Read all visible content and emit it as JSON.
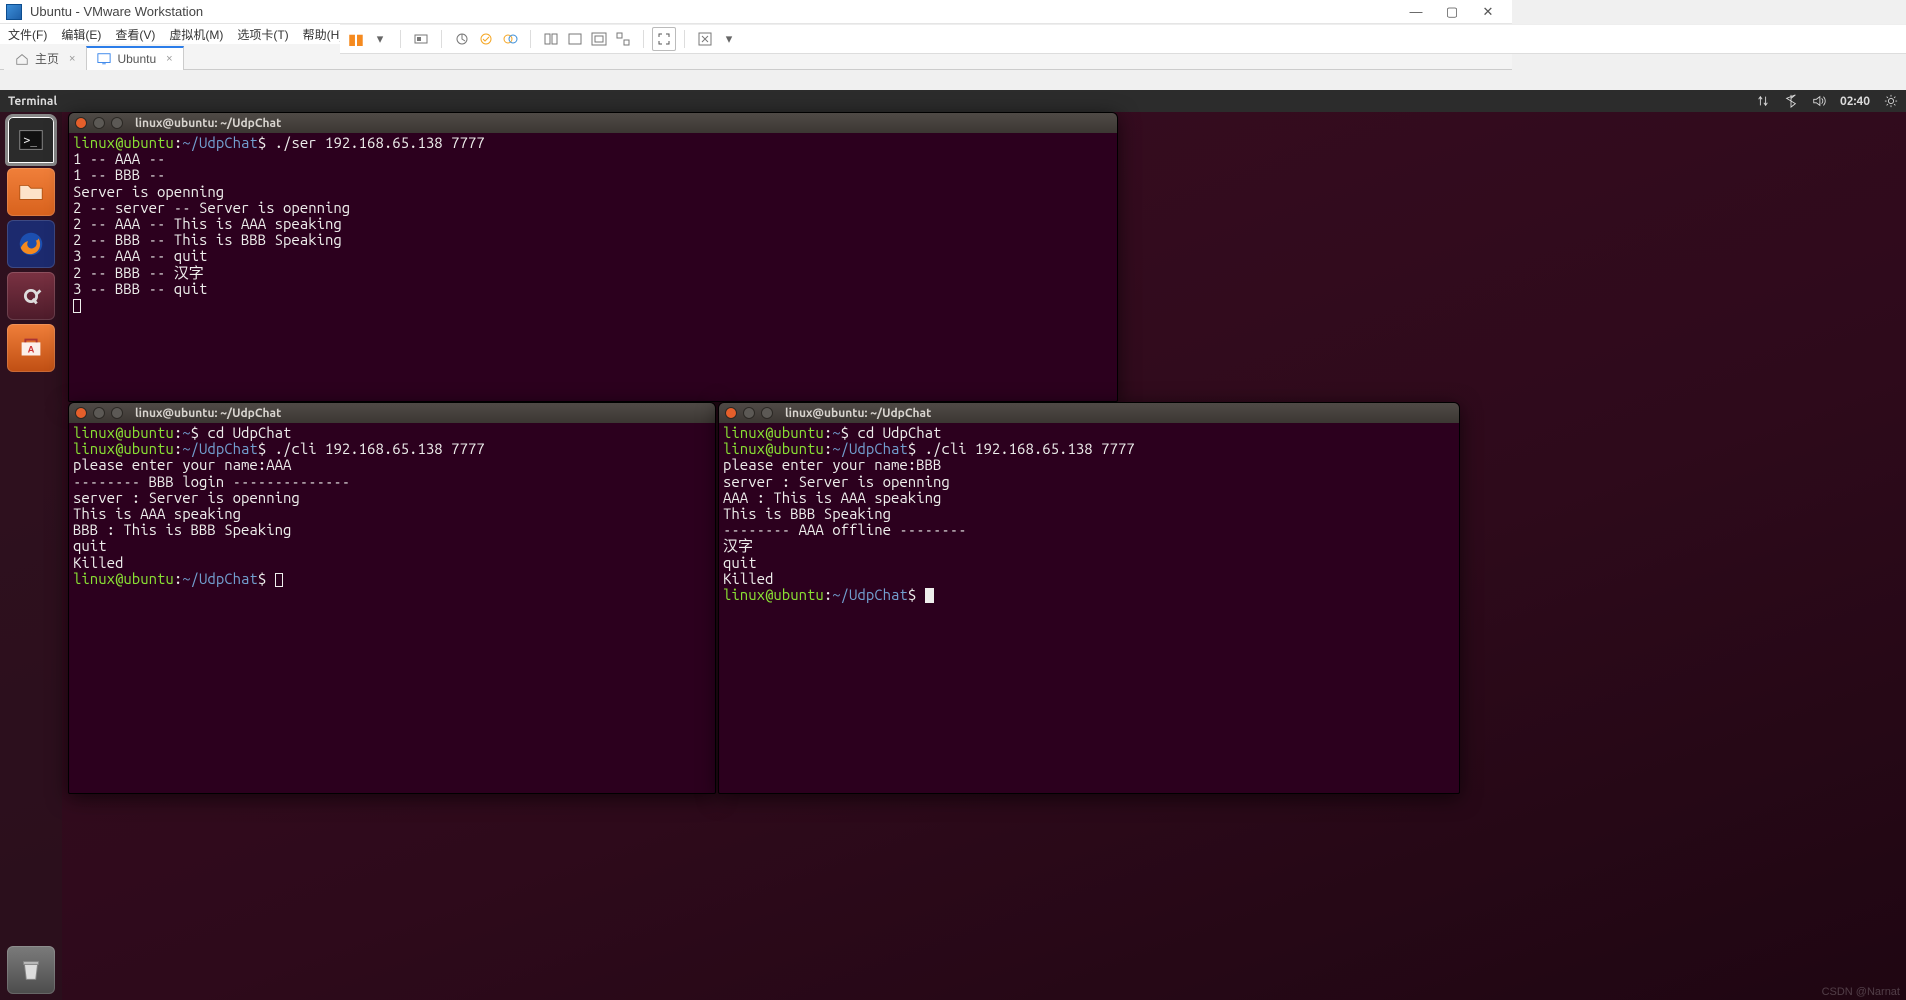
{
  "host": {
    "title": "Ubuntu - VMware Workstation",
    "menus": [
      "文件(F)",
      "编辑(E)",
      "查看(V)",
      "虚拟机(M)",
      "选项卡(T)",
      "帮助(H)"
    ],
    "tabs": [
      {
        "label": "主页",
        "active": false
      },
      {
        "label": "Ubuntu",
        "active": true
      }
    ]
  },
  "ubuntu_panel": {
    "app": "Terminal",
    "clock": "02:40"
  },
  "terminals": {
    "server": {
      "title": "linux@ubuntu: ~/UdpChat",
      "prompt_user": "linux@ubuntu",
      "prompt_path": "~/UdpChat",
      "command": "./ser 192.168.65.138 7777",
      "output": "1 -- AAA --\n1 -- BBB --\nServer is openning\n2 -- server -- Server is openning\n2 -- AAA -- This is AAA speaking\n2 -- BBB -- This is BBB Speaking\n3 -- AAA -- quit\n2 -- BBB -- 汉字\n3 -- BBB -- quit"
    },
    "client_a": {
      "title": "linux@ubuntu: ~/UdpChat",
      "prompt_user": "linux@ubuntu",
      "line1_path": "~",
      "line1_cmd": "cd UdpChat",
      "line2_path": "~/UdpChat",
      "line2_cmd": "./cli 192.168.65.138 7777",
      "output": "please enter your name:AAA\n-------- BBB login --------------\nserver : Server is openning\nThis is AAA speaking\nBBB : This is BBB Speaking\nquit\nKilled",
      "final_path": "~/UdpChat"
    },
    "client_b": {
      "title": "linux@ubuntu: ~/UdpChat",
      "prompt_user": "linux@ubuntu",
      "line1_path": "~",
      "line1_cmd": "cd UdpChat",
      "line2_path": "~/UdpChat",
      "line2_cmd": "./cli 192.168.65.138 7777",
      "output": "please enter your name:BBB\nserver : Server is openning\nAAA : This is AAA speaking\nThis is BBB Speaking\n-------- AAA offline --------\n汉字\nquit\nKilled",
      "final_path": "~/UdpChat"
    }
  },
  "watermark": "CSDN @Narnat"
}
